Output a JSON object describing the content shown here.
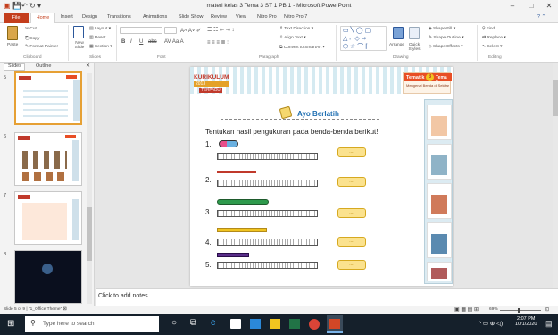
{
  "window": {
    "title": "materi kelas 3 Tema 3 ST 1 PB 1 - Microsoft PowerPoint"
  },
  "ribbon": {
    "tabs": [
      "File",
      "Home",
      "Insert",
      "Design",
      "Transitions",
      "Animations",
      "Slide Show",
      "Review",
      "View",
      "Nitro Pro",
      "Nitro Pro 7"
    ],
    "clipboard": {
      "paste": "Paste",
      "cut": "Cut",
      "copy": "Copy",
      "format_painter": "Format Painter",
      "label": "Clipboard"
    },
    "slides": {
      "new_slide": "New Slide",
      "layout": "Layout",
      "reset": "Reset",
      "section": "Section",
      "label": "Slides"
    },
    "font": {
      "bold": "B",
      "italic": "I",
      "underline": "U",
      "strike": "abc",
      "label": "Font"
    },
    "paragraph": {
      "text_direction": "Text Direction",
      "align_text": "Align Text",
      "convert": "Convert to SmartArt",
      "label": "Paragraph"
    },
    "drawing": {
      "arrange": "Arrange",
      "quick_styles": "Quick Styles",
      "shape_fill": "Shape Fill",
      "shape_outline": "Shape Outline",
      "shape_effects": "Shape Effects",
      "label": "Drawing"
    },
    "editing": {
      "find": "Find",
      "replace": "Replace",
      "select": "Select",
      "label": "Editing"
    }
  },
  "panel": {
    "tab_slides": "Slides",
    "tab_outline": "Outline",
    "slide_numbers": [
      "5",
      "6",
      "7",
      "8"
    ]
  },
  "slide": {
    "logo_top": "KURIKULUM",
    "logo_year": "2013",
    "logo_bottom": "TERPADU",
    "tema_label": "Tematik",
    "tema_num": "3",
    "tema_badge": "Tema 3",
    "tema_subtitle": "Mengenal Benda di Sekitar",
    "heading": "Ayo Berlatih",
    "instruction": "Tentukan hasil pengukuran  pada benda-benda berikut!",
    "items": [
      "1.",
      "2.",
      "3.",
      "4.",
      "5."
    ],
    "answer_placeholder": "...."
  },
  "notes": {
    "placeholder": "Click to add notes"
  },
  "status": {
    "slide_info": "Slide 5 of 9",
    "theme": "\"1_Office Theme\"",
    "zoom": "69%"
  },
  "taskbar": {
    "search_placeholder": "Type here to search",
    "time": "2:07 PM",
    "date": "10/1/2020"
  }
}
